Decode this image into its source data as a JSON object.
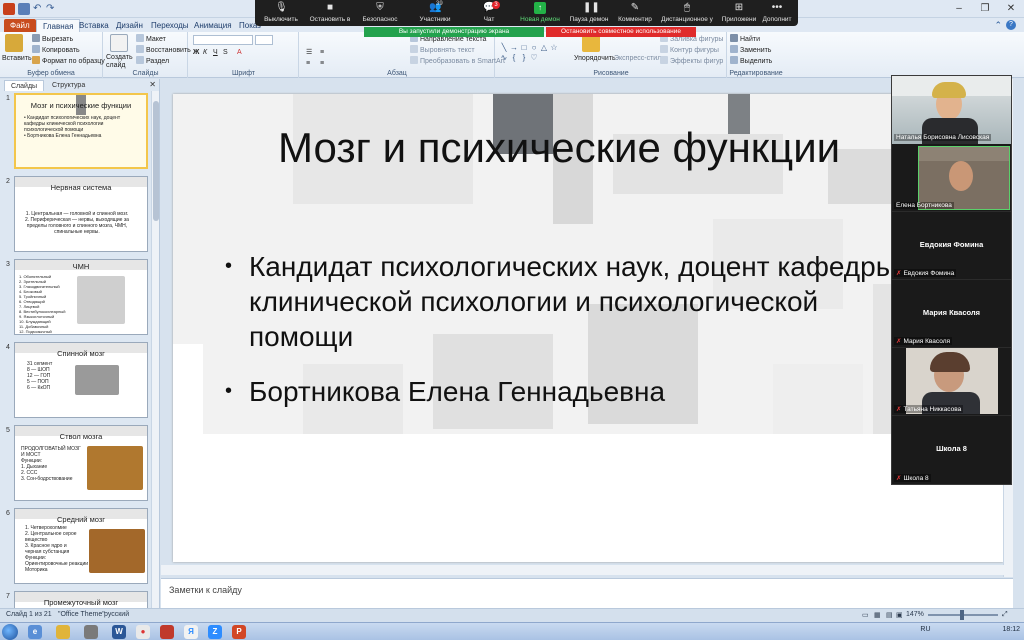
{
  "app": {
    "quick_access": [
      "save-icon",
      "undo-icon",
      "redo-icon",
      "customize-icon"
    ]
  },
  "ribbon_tabs": [
    "Файл",
    "Главная",
    "Вставка",
    "Дизайн",
    "Переходы",
    "Анимация",
    "Показ"
  ],
  "ribbon": {
    "clipboard": {
      "paste": "Вставить",
      "cut": "Вырезать",
      "copy": "Копировать",
      "format_painter": "Формат по образцу",
      "group": "Буфер обмена"
    },
    "slides": {
      "new_slide": "Создать слайд",
      "layout": "Макет",
      "reset": "Восстановить",
      "section": "Раздел",
      "group": "Слайды"
    },
    "font": {
      "group": "Шрифт"
    },
    "paragraph": {
      "text_direction": "Направление текста",
      "align_text": "Выровнять текст",
      "convert_smartart": "Преобразовать в SmartArt",
      "group": "Абзац"
    },
    "drawing": {
      "arrange": "Упорядочить",
      "quick_styles": "Экспресс-стили",
      "shape_fill": "Заливка фигуры",
      "shape_outline": "Контур фигуры",
      "shape_effects": "Эффекты фигур",
      "group": "Рисование"
    },
    "editing": {
      "find": "Найти",
      "replace": "Заменить",
      "select": "Выделить",
      "group": "Редактирование"
    }
  },
  "zoom_toolbar": {
    "items": [
      {
        "label": "Выключить",
        "icon": "microphone-icon"
      },
      {
        "label": "Остановить в",
        "icon": "video-camera-icon"
      },
      {
        "label": "Безопаснос",
        "icon": "shield-icon"
      },
      {
        "label": "Участники",
        "icon": "participants-icon"
      },
      {
        "label": "Чат",
        "icon": "chat-icon"
      },
      {
        "label": "Новая демон",
        "icon": "share-screen-icon"
      },
      {
        "label": "Пауза демон",
        "icon": "pause-icon"
      },
      {
        "label": "Комментир",
        "icon": "annotate-icon"
      },
      {
        "label": "Дистанционное у",
        "icon": "remote-control-icon"
      },
      {
        "label": "Приложени",
        "icon": "apps-icon"
      },
      {
        "label": "Дополнит",
        "icon": "more-icon"
      }
    ],
    "participants_count": "39",
    "chat_badge": "3",
    "sharing_banner": "Вы запустили демонстрацию экрана",
    "stop_sharing": "Остановить совместное использование"
  },
  "left_pane": {
    "tabs": [
      "Слайды",
      "Структура"
    ],
    "thumbnails": [
      {
        "num": "1",
        "title": "Мозг и психические функции",
        "body": "• Кандидат психологических наук, доцент\nкафедры клинической психологии\nпсихологической помощи\n• Бортникова Елена Геннадьевна"
      },
      {
        "num": "2",
        "title": "Нервная система",
        "body": "1. Центральная — головной и спинной мозг.\n2. Периферическая — нервы, выходящие за\nпределы головного и спинного мозга, ЧМН,\nспинальные нервы."
      },
      {
        "num": "3",
        "title": "ЧМН",
        "body": "1. Обонятельный\n2. Зрительный\n3. Глазодвигательный\n4. Блоковый\n5. Тройничный\n6. Отводящий\n7. Лицевой\n8. Вестибулокохлеарный\n9. Языкоглоточный\n10. Блуждающий\n11. Добавочный\n12. Подъязычный"
      },
      {
        "num": "4",
        "title": "Спинной мозг",
        "body": "31 сегмент\n8 — ШОП\n12 — ГОП\n5 — ПОП\n6 — КкОП"
      },
      {
        "num": "5",
        "title": "Ствол мозга",
        "body": "ПРОДОЛГОВАТЫЙ МОЗГ\nИ МОСТ\nФункции:\n1. Дыхание\n2. ССС\n3. Сон-бодрствование"
      },
      {
        "num": "6",
        "title": "Средний мозг",
        "body": "1. Четверохолмие\n2. Центральное серое\nвещество\n3. Красное ядро и\nчерная субстанция\nФункции:\nОриентировочные реакции\nМоторика"
      },
      {
        "num": "7",
        "title": "Промежуточный мозг",
        "body": ""
      }
    ]
  },
  "slide": {
    "title": "Мозг и психические функции",
    "bullets": [
      "Кандидат психологических наук, доцент кафедры клинической психологии и психологической помощи",
      "Бортникова Елена Геннадьевна"
    ]
  },
  "notes": {
    "placeholder": "Заметки к слайду"
  },
  "status": {
    "slide_counter": "Слайд 1 из 21",
    "theme": "\"Office Theme\"",
    "language": "русский",
    "zoom": "147%"
  },
  "gallery": [
    {
      "type": "video",
      "label": "Наталья Борисовна Лисовская",
      "muted": false
    },
    {
      "type": "video",
      "label": "Елена Бортникова",
      "muted": false
    },
    {
      "type": "name",
      "name": "Евдокия Фомина",
      "label": "Евдокия Фомина",
      "muted": true
    },
    {
      "type": "name",
      "name": "Мария Квасоля",
      "label": "Мария Квасоля",
      "muted": true
    },
    {
      "type": "video",
      "label": "Татьяна Никкасова",
      "muted": true
    },
    {
      "type": "name",
      "name": "Школа 8",
      "label": "Школа 8",
      "muted": true
    }
  ],
  "taskbar": {
    "tray_lang": "RU",
    "time": "18:12"
  }
}
